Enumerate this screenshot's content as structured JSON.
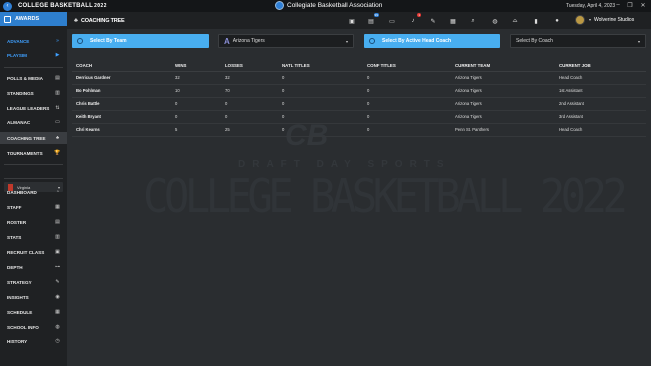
{
  "app": {
    "logo_text": "COLLEGE BASKETBALL",
    "logo_year": "2022",
    "window_title": "Collegiate Basketball Association",
    "date": "Tuesday, April 4, 2023"
  },
  "sidebar": {
    "header_label": "AWARDS",
    "items": [
      {
        "label": "ADVANCE",
        "icon": "»"
      },
      {
        "label": "PLAYSIM",
        "icon": "▶"
      },
      {
        "label": "POLLS & MEDIA",
        "icon": "▤"
      },
      {
        "label": "STANDINGS",
        "icon": "▥"
      },
      {
        "label": "LEAGUE LEADERS",
        "icon": "⇅"
      },
      {
        "label": "ALMANAC",
        "icon": "▭"
      },
      {
        "label": "COACHING TREE",
        "icon": "♣"
      },
      {
        "label": "TOURNAMENTS",
        "icon": "🏆"
      },
      {
        "label": "DASHBOARD",
        "icon": "◔"
      },
      {
        "label": "STAFF",
        "icon": "▦"
      },
      {
        "label": "ROSTER",
        "icon": "▤"
      },
      {
        "label": "STATS",
        "icon": "▥"
      },
      {
        "label": "RECRUIT CLASS",
        "icon": "▣"
      },
      {
        "label": "DEPTH",
        "icon": "⊶"
      },
      {
        "label": "STRATEGY",
        "icon": "✎"
      },
      {
        "label": "INSIGHTS",
        "icon": "◉"
      },
      {
        "label": "SCHEDULE",
        "icon": "▦"
      },
      {
        "label": "SCHOOL INFO",
        "icon": "◍"
      },
      {
        "label": "HISTORY",
        "icon": "◷"
      }
    ],
    "team_select": "Virginia"
  },
  "toolbar": {
    "page_title": "COACHING TREE",
    "badges": {
      "inbox": "99",
      "notifications": "1"
    },
    "user_name": "Wolverine Studios"
  },
  "filters": {
    "by_team_label": "Select By Team",
    "team_value": "Arizona Tigers",
    "by_coach_label": "Select By Active Head Coach",
    "coach_placeholder": "Select By Coach"
  },
  "table": {
    "headers": [
      "COACH",
      "WINS",
      "LOSSES",
      "NATL TITLES",
      "CONF TITLES",
      "CURRENT TEAM",
      "CURRENT JOB"
    ],
    "rows": [
      [
        "Derricus Gardner",
        "32",
        "32",
        "0",
        "0",
        "Arizona Tigers",
        "Head Coach"
      ],
      [
        "Bo Pohlman",
        "10",
        "70",
        "0",
        "0",
        "Arizona Tigers",
        "1st Assistant"
      ],
      [
        "Chris Battle",
        "0",
        "0",
        "0",
        "0",
        "Arizona Tigers",
        "2nd Assistant"
      ],
      [
        "Keith Bryant",
        "0",
        "0",
        "0",
        "0",
        "Arizona Tigers",
        "3rd Assistant"
      ],
      [
        "Chri Kearns",
        "5",
        "25",
        "0",
        "0",
        "Penn St. Panthers",
        "Head Coach"
      ]
    ]
  },
  "watermark": {
    "top": "CB",
    "middle": "DRAFT DAY SPORTS",
    "big": "COLLEGE BASKETBALL 2022"
  }
}
